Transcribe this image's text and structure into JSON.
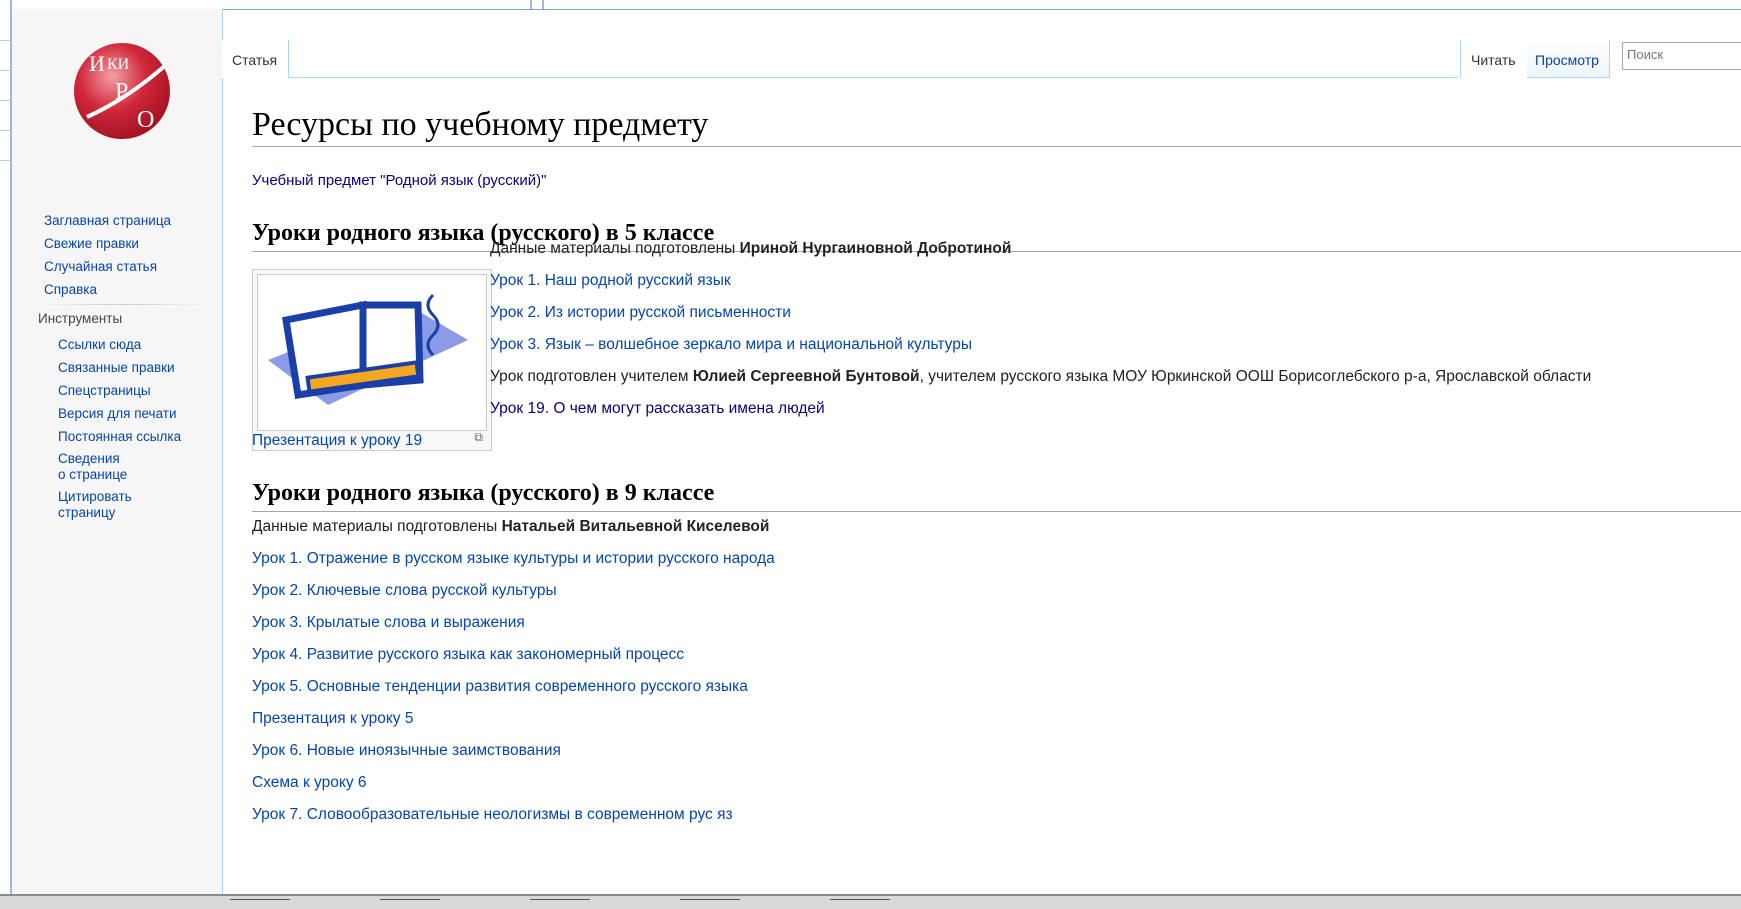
{
  "logo_text": "ВИКИ РО",
  "sidebar": {
    "nav": [
      "Заглавная страница",
      "Свежие правки",
      "Случайная статья",
      "Справка"
    ],
    "tools_heading": "Инструменты",
    "tools": [
      "Ссылки сюда",
      "Связанные правки",
      "Спецстраницы",
      "Версия для печати",
      "Постоянная ссылка"
    ],
    "tools_two_line": [
      {
        "l1": "Сведения",
        "l2": "о странице"
      },
      {
        "l1": "Цитировать",
        "l2": "страницу"
      }
    ]
  },
  "tabs": {
    "article": "Статья",
    "read": "Читать",
    "view": "Просмотр"
  },
  "search": {
    "placeholder": "Поиск"
  },
  "page": {
    "title": "Ресурсы по учебному предмету",
    "subject": "Учебный предмет \"Родной язык (русский)\"",
    "section1": {
      "heading": "Уроки родного языка (русского) в 5 классе",
      "prepared_prefix": "Данные материалы подготовлены ",
      "prepared_author": "Ириной Нургаиновной Добротиной",
      "links": [
        "Урок 1. Наш родной русский язык",
        "Урок 2. Из истории русской письменности",
        "Урок 3. Язык – волшебное зеркало мира и национальной культуры"
      ],
      "teacher_prefix": "Урок подготовлен учителем ",
      "teacher_name": "Юлией Сергеевной Бунтовой",
      "teacher_suffix": ", учителем русского языка МОУ Юркинской ООШ Борисоглебского р-а, Ярославской области",
      "lesson19": "Урок 19. О чем могут рассказать имена людей",
      "presentation19": "Презентация к уроку 19"
    },
    "section2": {
      "heading": "Уроки родного языка (русского) в 9 классе",
      "prepared_prefix": "Данные материалы подготовлены ",
      "prepared_author": "Натальей Витальевной Киселевой",
      "links": [
        "Урок 1. Отражение в русском языке культуры и истории русского народа",
        "Урок 2. Ключевые слова русской культуры",
        "Урок 3. Крылатые слова и выражения",
        "Урок 4. Развитие русского языка как закономерный процесс",
        "Урок 5. Основные тенденции развития современного русского языка",
        "Презентация к уроку 5",
        "Урок 6. Новые иноязычные заимствования",
        "Схема к уроку 6",
        "Урок 7. Словообразовательные неологизмы в современном рус яз"
      ]
    }
  }
}
